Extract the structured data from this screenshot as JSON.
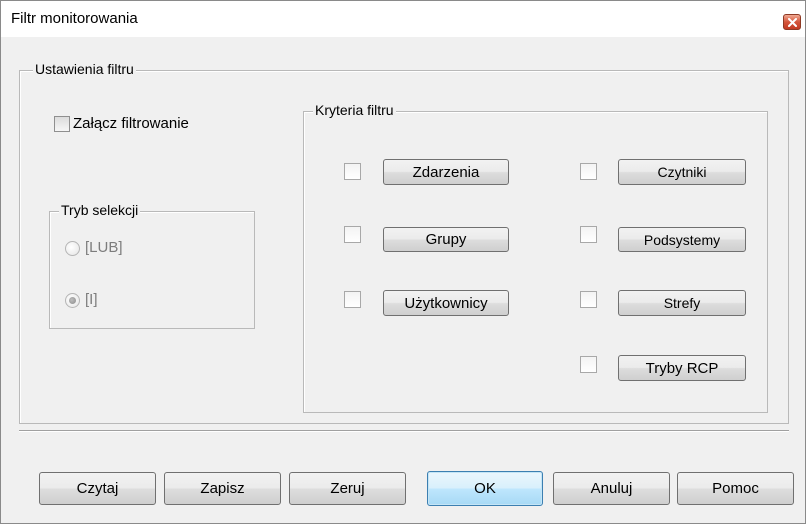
{
  "window": {
    "title": "Filtr monitorowania",
    "close_icon": "close-icon",
    "accent_close_color": "#d4553b"
  },
  "settings": {
    "group_label": "Ustawienia filtru",
    "enable_filter_label": "Załącz filtrowanie",
    "enable_filter_checked": false
  },
  "selection_mode": {
    "group_label": "Tryb selekcji",
    "options": [
      {
        "label": "[LUB]",
        "selected": false,
        "enabled": false
      },
      {
        "label": "[I]",
        "selected": true,
        "enabled": false
      }
    ]
  },
  "criteria": {
    "group_label": "Kryteria filtru",
    "items": [
      {
        "label": "Zdarzenia",
        "checked": false
      },
      {
        "label": "Grupy",
        "checked": false
      },
      {
        "label": "Użytkownicy",
        "checked": false
      },
      {
        "label": "Czytniki",
        "checked": false
      },
      {
        "label": "Podsystemy",
        "checked": false
      },
      {
        "label": "Strefy",
        "checked": false
      },
      {
        "label": "Tryby RCP",
        "checked": false
      }
    ]
  },
  "footer": {
    "read_label": "Czytaj",
    "save_label": "Zapisz",
    "reset_label": "Zeruj",
    "ok_label": "OK",
    "cancel_label": "Anuluj",
    "help_label": "Pomoc",
    "ok_accent_color": "#3c7fb1"
  }
}
